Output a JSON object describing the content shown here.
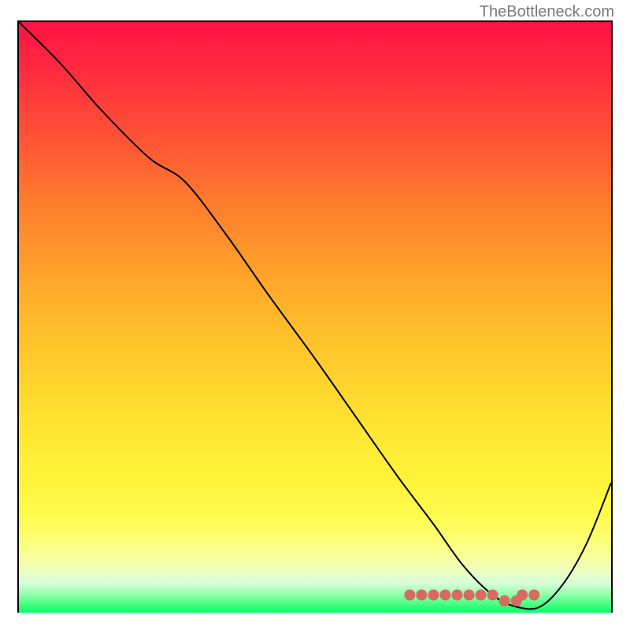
{
  "watermark": "TheBottleneck.com",
  "chart_data": {
    "type": "line",
    "title": "",
    "xlabel": "",
    "ylabel": "",
    "xlim": [
      0,
      100
    ],
    "ylim": [
      0,
      100
    ],
    "series": [
      {
        "name": "curve",
        "x": [
          0,
          7,
          14,
          22,
          28,
          35,
          42,
          50,
          57,
          64,
          70,
          75,
          80,
          84,
          88,
          92,
          96,
          100
        ],
        "values": [
          100,
          93,
          85,
          77,
          73,
          64,
          54,
          43,
          33,
          23,
          15,
          8,
          3,
          1,
          1,
          5,
          12,
          22
        ]
      }
    ],
    "markers": {
      "name": "highlight",
      "color": "#d86a62",
      "x": [
        66,
        68,
        70,
        72,
        74,
        76,
        78,
        80,
        82,
        84,
        85,
        87
      ],
      "values": [
        3,
        3,
        3,
        3,
        3,
        3,
        3,
        3,
        2,
        2,
        3,
        3
      ]
    }
  }
}
